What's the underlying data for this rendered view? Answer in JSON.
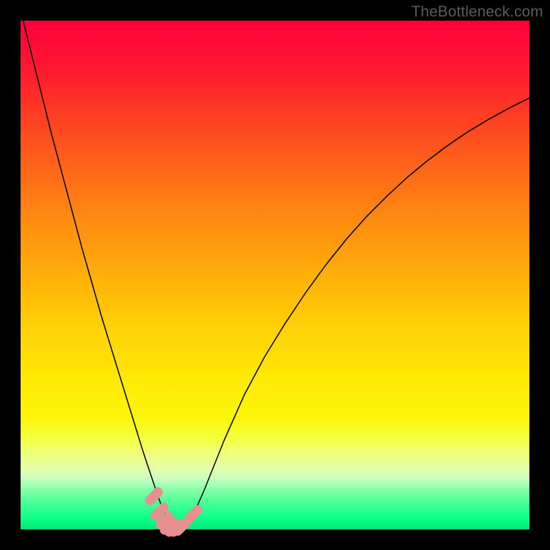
{
  "watermark": "TheBottleneck.com",
  "colors": {
    "background": "#000000",
    "curve": "#000000",
    "marker": "#e89090",
    "gradient_top": "#ff003b",
    "gradient_bottom": "#00e676"
  },
  "chart_data": {
    "type": "line",
    "title": "",
    "xlabel": "",
    "ylabel": "",
    "xlim": [
      0,
      100
    ],
    "ylim": [
      0,
      100
    ],
    "grid": false,
    "curve": {
      "x": [
        0,
        2,
        4,
        6,
        8,
        10,
        12,
        14,
        16,
        18,
        20,
        22,
        24,
        25,
        26,
        27,
        28,
        29,
        30,
        31,
        32,
        34,
        36,
        38,
        40,
        44,
        48,
        52,
        56,
        60,
        64,
        68,
        72,
        76,
        80,
        84,
        88,
        92,
        96,
        100
      ],
      "y": [
        102,
        94,
        86,
        78,
        70.5,
        63,
        55.5,
        48.5,
        41.5,
        35,
        28.5,
        22,
        15.5,
        12.5,
        9.5,
        6.5,
        3.8,
        1.6,
        0.4,
        0.2,
        0.7,
        3.0,
        7.5,
        12.5,
        17.5,
        26.5,
        34.0,
        40.5,
        46.5,
        52.0,
        57.0,
        61.5,
        65.5,
        69.2,
        72.5,
        75.5,
        78.2,
        80.6,
        82.8,
        84.8
      ]
    },
    "markers": {
      "x": [
        26.2,
        27.3,
        28.3,
        29.1,
        30.0,
        30.8,
        31.7,
        34.0
      ],
      "y": [
        6.5,
        3.5,
        1.7,
        0.7,
        0.3,
        0.3,
        0.5,
        3.0
      ]
    }
  }
}
